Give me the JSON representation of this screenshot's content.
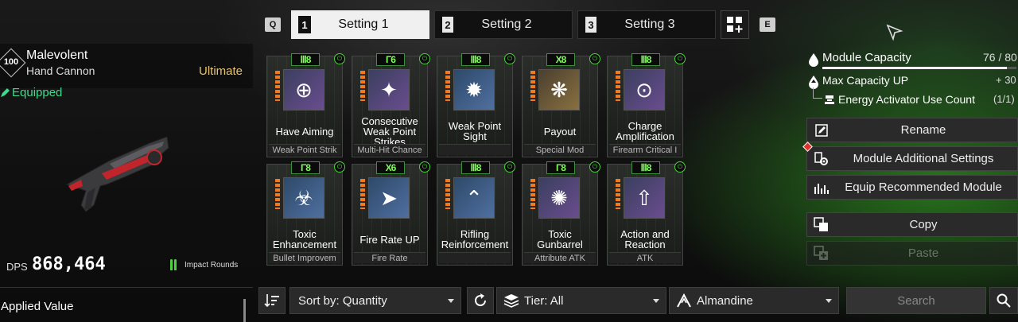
{
  "tabs": {
    "prev_key": "Q",
    "next_key": "E",
    "items": [
      {
        "num": "1",
        "label": "Setting 1"
      },
      {
        "num": "2",
        "label": "Setting 2"
      },
      {
        "num": "3",
        "label": "Setting 3"
      }
    ]
  },
  "weapon": {
    "level": "100",
    "name": "Malevolent",
    "type": "Hand Cannon",
    "rarity": "Ultimate",
    "status": "Equipped",
    "dps_label": "DPS",
    "dps_value": "868,464",
    "ammo": "Impact Rounds",
    "applied_value": "Applied Value"
  },
  "modules": [
    {
      "cost": "Ⅲ8",
      "name": "Have Aiming",
      "category": "Weak Point Strik",
      "icon": "crosshair-icon",
      "color": "purple"
    },
    {
      "cost": "Γ6",
      "name": "Consecutive\nWeak Point\nStrikes",
      "category": "Multi-Hit Chance",
      "icon": "shatter-icon",
      "color": "purple"
    },
    {
      "cost": "Ⅲ8",
      "name": "Weak Point Sight",
      "category": "",
      "icon": "burst-icon",
      "color": "blue"
    },
    {
      "cost": "X8",
      "name": "Payout",
      "category": "Special Mod",
      "icon": "brain-icon",
      "color": "gold"
    },
    {
      "cost": "Ⅲ8",
      "name": "Charge\nAmplification",
      "category": "Firearm Critical I",
      "icon": "charge-icon",
      "color": "purple"
    },
    {
      "cost": "Γ8",
      "name": "Toxic\nEnhancement",
      "category": "Bullet Improvem",
      "icon": "toxic-icon",
      "color": "blue"
    },
    {
      "cost": "X6",
      "name": "Fire Rate UP",
      "category": "Fire Rate",
      "icon": "bullets-icon",
      "color": "blue"
    },
    {
      "cost": "Ⅲ8",
      "name": "Rifling\nReinforcement",
      "category": "",
      "icon": "rifling-icon",
      "color": "blue"
    },
    {
      "cost": "Γ8",
      "name": "Toxic Gunbarrel",
      "category": "Attribute ATK",
      "icon": "gunbarrel-icon",
      "color": "purple"
    },
    {
      "cost": "Ⅲ8",
      "name": "Action and\nReaction",
      "category": "ATK",
      "icon": "reaction-icon",
      "color": "purple"
    }
  ],
  "capacity": {
    "label": "Module Capacity",
    "value": "76 / 80",
    "fill_fraction": 0.95,
    "max_up_label": "Max Capacity UP",
    "max_up_value": "+ 30",
    "activator_label": "Energy Activator Use Count",
    "activator_value": "(1/1)"
  },
  "actions": {
    "rename": "Rename",
    "additional": "Module Additional Settings",
    "recommended": "Equip Recommended Module",
    "copy": "Copy",
    "paste": "Paste"
  },
  "filters": {
    "sort": "Sort by: Quantity",
    "tier": "Tier: All",
    "socket": "Almandine",
    "search_placeholder": "Search"
  },
  "colors": {
    "accent_green": "#4bd23c",
    "equipped_green": "#3ddc8a",
    "ultimate_gold": "#e8c46a",
    "bar_orange": "#f07a20"
  }
}
